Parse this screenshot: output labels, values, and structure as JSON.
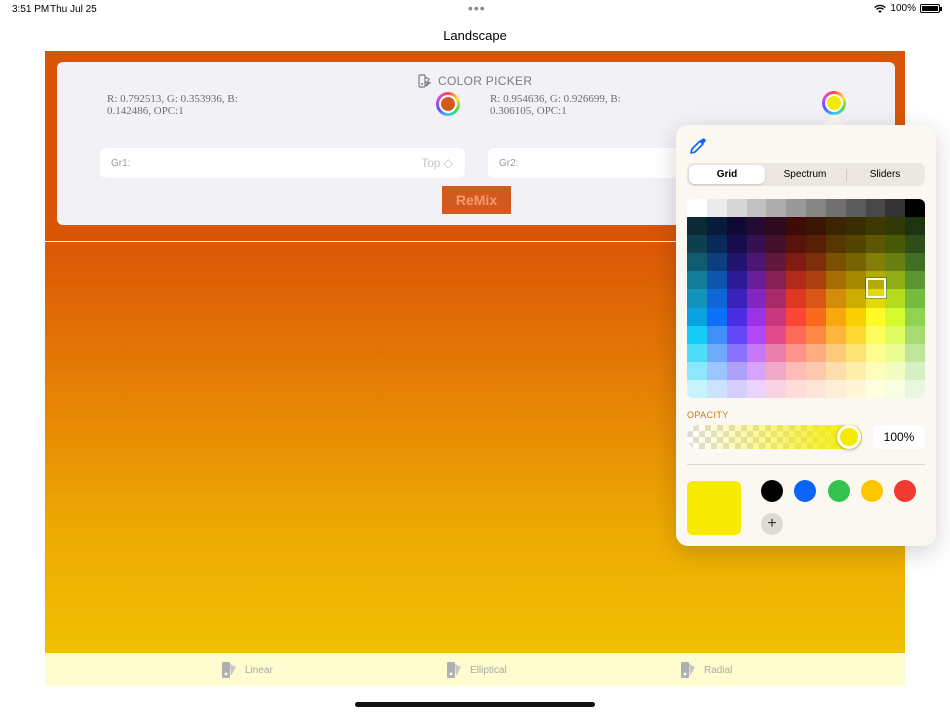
{
  "status_bar": {
    "time": "3:51 PM",
    "date": "Thu Jul 25",
    "dots": "•••",
    "battery": "100%"
  },
  "nav": {
    "title": "Landscape"
  },
  "picker": {
    "title": "COLOR PICKER",
    "left_rgb": "R: 0.792513, G: 0.353936, B: 0.142486, OPC:1",
    "right_rgb": "R: 0.954636, G: 0.926699, B: 0.306105, OPC:1",
    "left_color": "#d35a1d",
    "right_color": "#f3ea05",
    "gr1_label": "Gr1:",
    "gr1_value": "Top ◇",
    "gr2_label": "Gr2:",
    "remix_label": "ReMix"
  },
  "tabs": [
    {
      "label": "Linear",
      "icon": "gradient-linear-icon"
    },
    {
      "label": "Elliptical",
      "icon": "gradient-elliptical-icon"
    },
    {
      "label": "Radial",
      "icon": "gradient-radial-icon"
    }
  ],
  "popover": {
    "segments": [
      "Grid",
      "Spectrum",
      "Sliders"
    ],
    "active_segment": "Grid",
    "opacity_label": "OPACITY",
    "opacity_value": "100%",
    "opacity": 1.0,
    "current_color": "#f5ea00",
    "preset_colors": [
      "#000000",
      "#0a64f5",
      "#34c34e",
      "#fcc700",
      "#f23b30"
    ],
    "add_label": "+",
    "grid_rows": [
      [
        "#ffffff",
        "#ebebeb",
        "#d6d6d6",
        "#c2c2c2",
        "#adadad",
        "#999999",
        "#858585",
        "#707070",
        "#5c5c5c",
        "#474747",
        "#333333",
        "#000000"
      ],
      [
        "#0b2a35",
        "#081b3b",
        "#0f0a33",
        "#250a33",
        "#2e0a1c",
        "#3d0a08",
        "#3b1404",
        "#3a2401",
        "#372d00",
        "#3c3a02",
        "#2f3a05",
        "#1e3410"
      ],
      [
        "#0f3e4c",
        "#092a58",
        "#170d4d",
        "#361050",
        "#44112a",
        "#5a130c",
        "#581f07",
        "#563701",
        "#534400",
        "#5b5703",
        "#475809",
        "#2e4e19"
      ],
      [
        "#115b6e",
        "#0d3e80",
        "#22136e",
        "#4c1672",
        "#62183d",
        "#821c12",
        "#7e2e0b",
        "#7a5003",
        "#776300",
        "#837e05",
        "#67800f",
        "#426f24"
      ],
      [
        "#137c96",
        "#0f55ae",
        "#2d1a96",
        "#681e9b",
        "#852253",
        "#b12a1a",
        "#ac4110",
        "#a76d05",
        "#a38800",
        "#b3ac08",
        "#8fae16",
        "#5b9631"
      ],
      [
        "#1393bb",
        "#0f66d8",
        "#3922bb",
        "#8226c2",
        "#a72b68",
        "#df3625",
        "#da5617",
        "#d38b09",
        "#cdad00",
        "#e0d90b",
        "#b4db1f",
        "#73bc3f"
      ],
      [
        "#0aa3e2",
        "#0c71f8",
        "#4a2de0",
        "#9a32e5",
        "#c9387e",
        "#fb4535",
        "#fa6a1d",
        "#f8a80e",
        "#f8d000",
        "#fff925",
        "#d5fb2e",
        "#8fd44e"
      ],
      [
        "#14ccf5",
        "#3f8ff8",
        "#6447f8",
        "#b348f8",
        "#e14b8d",
        "#fc6a5a",
        "#fc8843",
        "#fcb63d",
        "#fcd933",
        "#fefb5c",
        "#e0fb62",
        "#a8dc72"
      ],
      [
        "#4edcf7",
        "#6daafa",
        "#8a73fa",
        "#c677fa",
        "#ea7fac",
        "#fd938a",
        "#fdab7f",
        "#fdca7c",
        "#fde374",
        "#fefc8c",
        "#eafd95",
        "#c0e69b"
      ],
      [
        "#8be8fa",
        "#9bc5fb",
        "#ae9ffb",
        "#d8a4fb",
        "#f1a9c8",
        "#fdbcb6",
        "#fdc9af",
        "#fdddac",
        "#feeeaa",
        "#fefdbc",
        "#f2fdc2",
        "#d6efc3"
      ],
      [
        "#c6f4fd",
        "#cde2fd",
        "#d6cffd",
        "#ecd3fd",
        "#f8d4e3",
        "#fedddb",
        "#fee5d8",
        "#feeed6",
        "#fef6d5",
        "#fffede",
        "#f8fee1",
        "#e9f7e1"
      ]
    ]
  }
}
